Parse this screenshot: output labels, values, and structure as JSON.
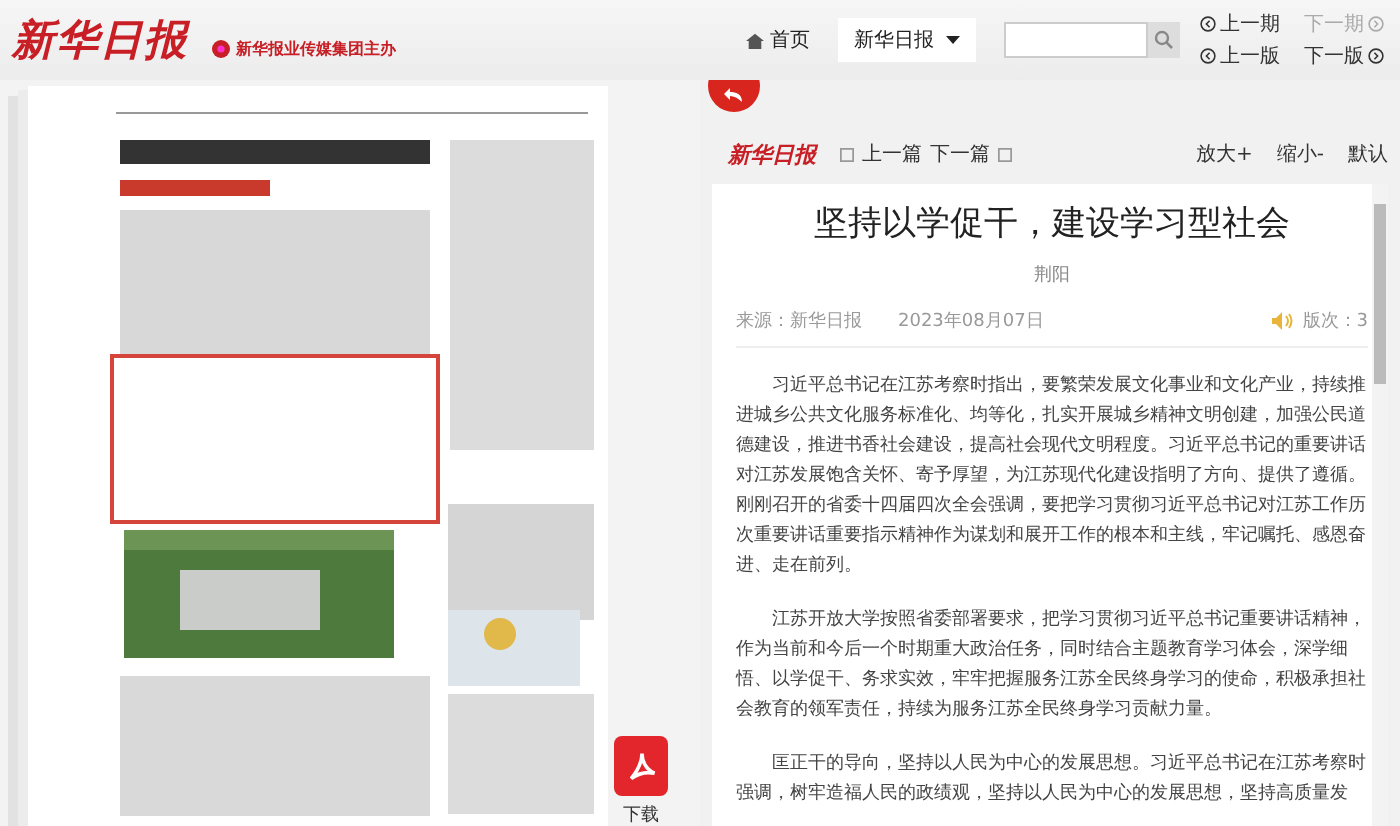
{
  "header": {
    "logo": "新华日报",
    "publisher": "新华报业传媒集团主办",
    "home": "首页",
    "edition_select": "新华日报",
    "nav": [
      {
        "label": "上一期",
        "kind": "prev",
        "disabled": false
      },
      {
        "label": "下一期",
        "kind": "next",
        "disabled": true
      },
      {
        "label": "上一版",
        "kind": "prev",
        "disabled": false
      },
      {
        "label": "下一版",
        "kind": "next",
        "disabled": false
      }
    ]
  },
  "page_view": {
    "download": "下载"
  },
  "article": {
    "logo": "新华日报",
    "prev": "上一篇",
    "next": "下一篇",
    "zoom": [
      "放大+",
      "缩小-",
      "默认"
    ],
    "title": "坚持以学促干，建设学习型社会",
    "author": "荆阳",
    "source": "来源：新华日报",
    "date": "2023年08月07日",
    "edition": "版次：3",
    "paragraphs": [
      "习近平总书记在江苏考察时指出，要繁荣发展文化事业和文化产业，持续推进城乡公共文化服务标准化、均等化，扎实开展城乡精神文明创建，加强公民道德建设，推进书香社会建设，提高社会现代文明程度。习近平总书记的重要讲话对江苏发展饱含关怀、寄予厚望，为江苏现代化建设指明了方向、提供了遵循。刚刚召开的省委十四届四次全会强调，要把学习贯彻习近平总书记对江苏工作历次重要讲话重要指示精神作为谋划和展开工作的根本和主线，牢记嘱托、感恩奋进、走在前列。",
      "江苏开放大学按照省委部署要求，把学习贯彻习近平总书记重要讲话精神，作为当前和今后一个时期重大政治任务，同时结合主题教育学习体会，深学细悟、以学促干、务求实效，牢牢把握服务江苏全民终身学习的使命，积极承担社会教育的领军责任，持续为服务江苏全民终身学习贡献力量。",
      "匡正干的导向，坚持以人民为中心的发展思想。习近平总书记在江苏考察时强调，树牢造福人民的政绩观，坚持以人民为中心的发展思想，坚持高质量发"
    ]
  }
}
